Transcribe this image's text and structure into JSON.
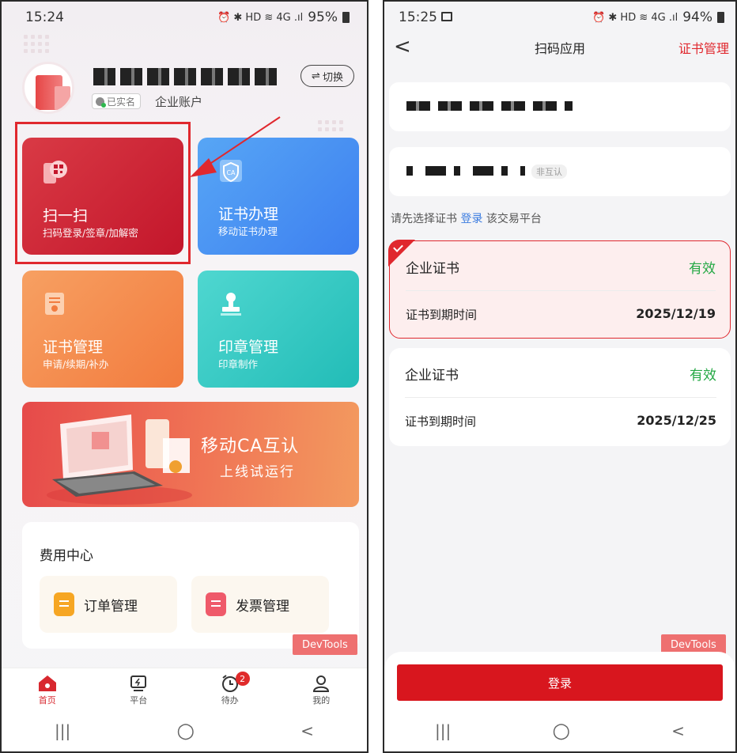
{
  "left": {
    "status": {
      "time": "15:24",
      "icons": "⏰ ✱ HD ≋ 4G .ıl",
      "battery": "95%"
    },
    "profile": {
      "name_redacted": true,
      "verified": "已实名",
      "account_type": "企业账户",
      "switch_label": "切换",
      "switch_icon": "⇌"
    },
    "cards": [
      {
        "title": "扫一扫",
        "subtitle": "扫码登录/签章/加解密"
      },
      {
        "title": "证书办理",
        "subtitle": "移动证书办理"
      },
      {
        "title": "证书管理",
        "subtitle": "申请/续期/补办"
      },
      {
        "title": "印章管理",
        "subtitle": "印章制作"
      }
    ],
    "banner": {
      "title": "移动CA互认",
      "subtitle": "上线试运行"
    },
    "fee": {
      "title": "费用中心",
      "order": "订单管理",
      "invoice": "发票管理"
    },
    "devtools": "DevTools",
    "tabs": [
      {
        "label": "首页",
        "icon": "home-icon",
        "active": true
      },
      {
        "label": "平台",
        "icon": "platform-icon"
      },
      {
        "label": "待办",
        "icon": "todo-icon",
        "badge": "2"
      },
      {
        "label": "我的",
        "icon": "user-icon"
      }
    ],
    "nav": {
      "recent": "|||",
      "home": "○",
      "back": "<"
    },
    "highlight_color": "#e0282e"
  },
  "right": {
    "status": {
      "time": "15:25",
      "icons": "⏰ ✱ HD ≋ 4G .ıl",
      "battery": "94%"
    },
    "header": {
      "back": "<",
      "title": "扫码应用",
      "manage": "证书管理"
    },
    "tag": "非互认",
    "hint": {
      "before": "请先选择证书",
      "link": "登录",
      "after": "该交易平台"
    },
    "certs": [
      {
        "name": "企业证书",
        "status": "有效",
        "expiry_label": "证书到期时间",
        "expiry": "2025/12/19",
        "selected": true
      },
      {
        "name": "企业证书",
        "status": "有效",
        "expiry_label": "证书到期时间",
        "expiry": "2025/12/25",
        "selected": false
      }
    ],
    "devtools": "DevTools",
    "login": "登录",
    "nav": {
      "recent": "|||",
      "home": "○",
      "back": "<"
    }
  }
}
